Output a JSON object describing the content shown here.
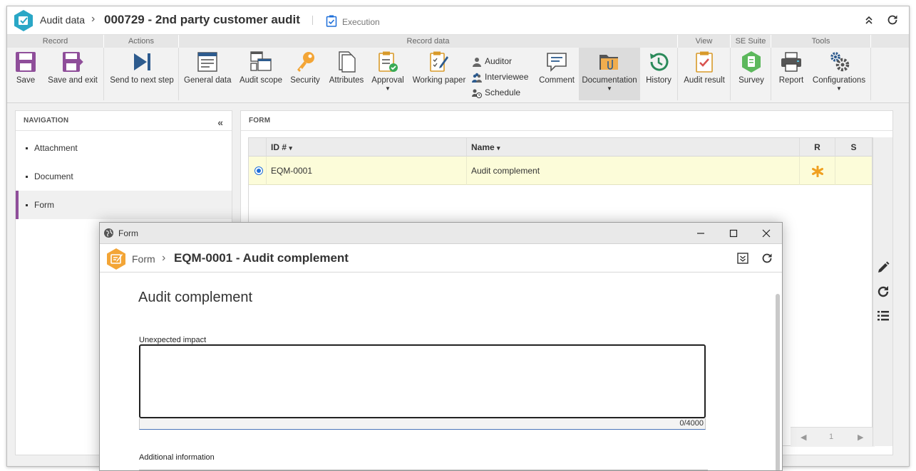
{
  "header": {
    "breadcrumb_root": "Audit data",
    "record_title": "000729 - 2nd party customer audit",
    "status_label": "Execution"
  },
  "ribbon": {
    "groups": {
      "record": "Record",
      "actions": "Actions",
      "record_data": "Record data",
      "view": "View",
      "se_suite": "SE Suite",
      "tools": "Tools"
    },
    "buttons": {
      "save": "Save",
      "save_exit": "Save and exit",
      "send_next": "Send to next step",
      "general_data": "General data",
      "audit_scope": "Audit scope",
      "security": "Security",
      "attributes": "Attributes",
      "approval": "Approval",
      "working_paper": "Working paper",
      "auditor": "Auditor",
      "interviewee": "Interviewee",
      "schedule": "Schedule",
      "comment": "Comment",
      "documentation": "Documentation",
      "history": "History",
      "audit_result": "Audit result",
      "survey": "Survey",
      "report": "Report",
      "configurations": "Configurations"
    }
  },
  "navigation": {
    "title": "NAVIGATION",
    "items": [
      {
        "label": "Attachment"
      },
      {
        "label": "Document"
      },
      {
        "label": "Form"
      }
    ]
  },
  "form_panel": {
    "title": "FORM",
    "columns": {
      "id": "ID #",
      "name": "Name",
      "r": "R",
      "s": "S"
    },
    "rows": [
      {
        "id": "EQM-0001",
        "name": "Audit complement"
      }
    ],
    "pager": {
      "page": "1"
    }
  },
  "modal": {
    "window_title": "Form",
    "crumb": "Form",
    "title": "EQM-0001 - Audit complement",
    "heading": "Audit complement",
    "field1_label": "Unexpected impact",
    "field1_value": "",
    "field1_counter": "0/4000",
    "field2_label": "Additional information"
  },
  "colors": {
    "accent_purple": "#8f4e9a",
    "row_highlight": "#fcfcd9",
    "selection_blue": "#1e6fd9",
    "logo_teal": "#2aa7c6",
    "form_badge_orange": "#f3a536"
  }
}
